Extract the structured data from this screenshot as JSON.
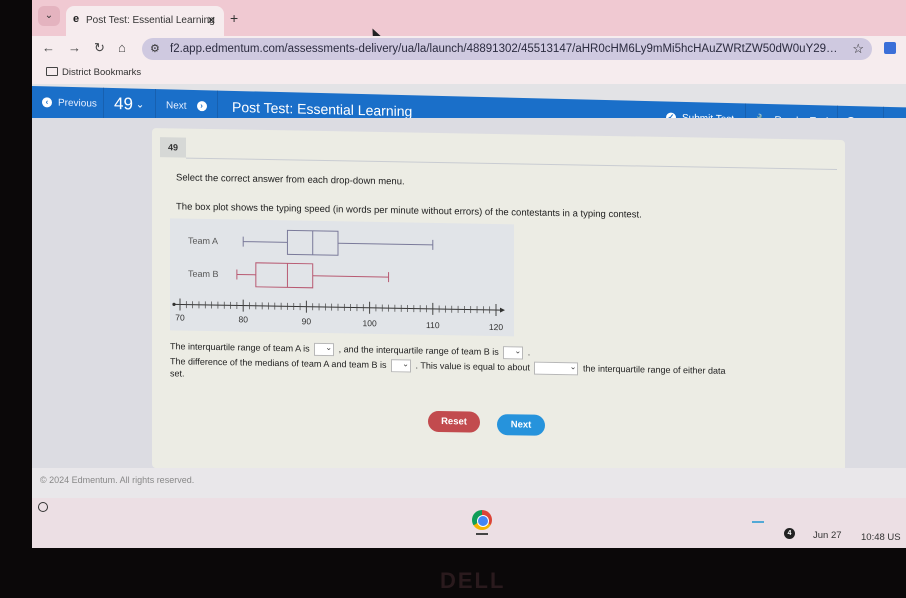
{
  "browser": {
    "tab_title": "Post Test: Essential Learning",
    "tab_favicon": "edmentum-e-icon",
    "new_tab_label": "+",
    "url": "f2.app.edmentum.com/assessments-delivery/ua/la/launch/48891302/45513147/aHR0cHM6Ly9mMi5hcHAuZWRtZW50dW0uY29tL2xlYXJuZXItdWkvc2Vjb2...",
    "bookmarks_folder": "District Bookmarks"
  },
  "appbar": {
    "previous_label": "Previous",
    "question_number": "49",
    "next_label": "Next",
    "title": "Post Test: Essential Learning",
    "submit_label": "Submit Test",
    "reader_tools_label": "Reader Tools",
    "info_label": "Info",
    "colors": {
      "primary": "#1a6fc9"
    }
  },
  "question": {
    "number": "49",
    "instruction": "Select the correct answer from each drop-down menu.",
    "prompt": "The box plot shows the typing speed (in words per minute without errors) of the contestants in a typing contest.",
    "line1_part1": "The interquartile range of team A is",
    "line1_part2": ", and the interquartile range of team B is",
    "line1_end": ".",
    "line2_part1": "The difference of the medians of team A and team B is",
    "line2_part2": ". This value is equal to about",
    "line2_part3": "the interquartile range of either data",
    "line3": "set.",
    "dropdowns": [
      {
        "id": "iqr-team-a",
        "selected": ""
      },
      {
        "id": "iqr-team-b",
        "selected": ""
      },
      {
        "id": "median-difference",
        "selected": ""
      },
      {
        "id": "fraction-of-iqr",
        "selected": ""
      }
    ]
  },
  "chart_data": {
    "type": "boxplot",
    "title": "",
    "xlabel": "",
    "ylabel": "",
    "axis": {
      "min": 70,
      "max": 120,
      "major_step": 10,
      "minor_step": 1,
      "tick_labels": [
        "70",
        "80",
        "90",
        "100",
        "110",
        "120"
      ]
    },
    "series": [
      {
        "name": "Team A",
        "min": 80,
        "q1": 87,
        "median": 91,
        "q3": 95,
        "max": 110,
        "color": "#7a7a9a"
      },
      {
        "name": "Team B",
        "min": 79,
        "q1": 82,
        "median": 87,
        "q3": 91,
        "max": 103,
        "color": "#b85a72"
      }
    ]
  },
  "actions": {
    "reset_label": "Reset",
    "next_label": "Next"
  },
  "footer": {
    "copyright": "© 2024 Edmentum. All rights reserved."
  },
  "shelf": {
    "notification_count": "4",
    "date": "Jun 27",
    "time": "10:48",
    "locale": "US"
  },
  "hardware": {
    "brand": "DELL"
  }
}
